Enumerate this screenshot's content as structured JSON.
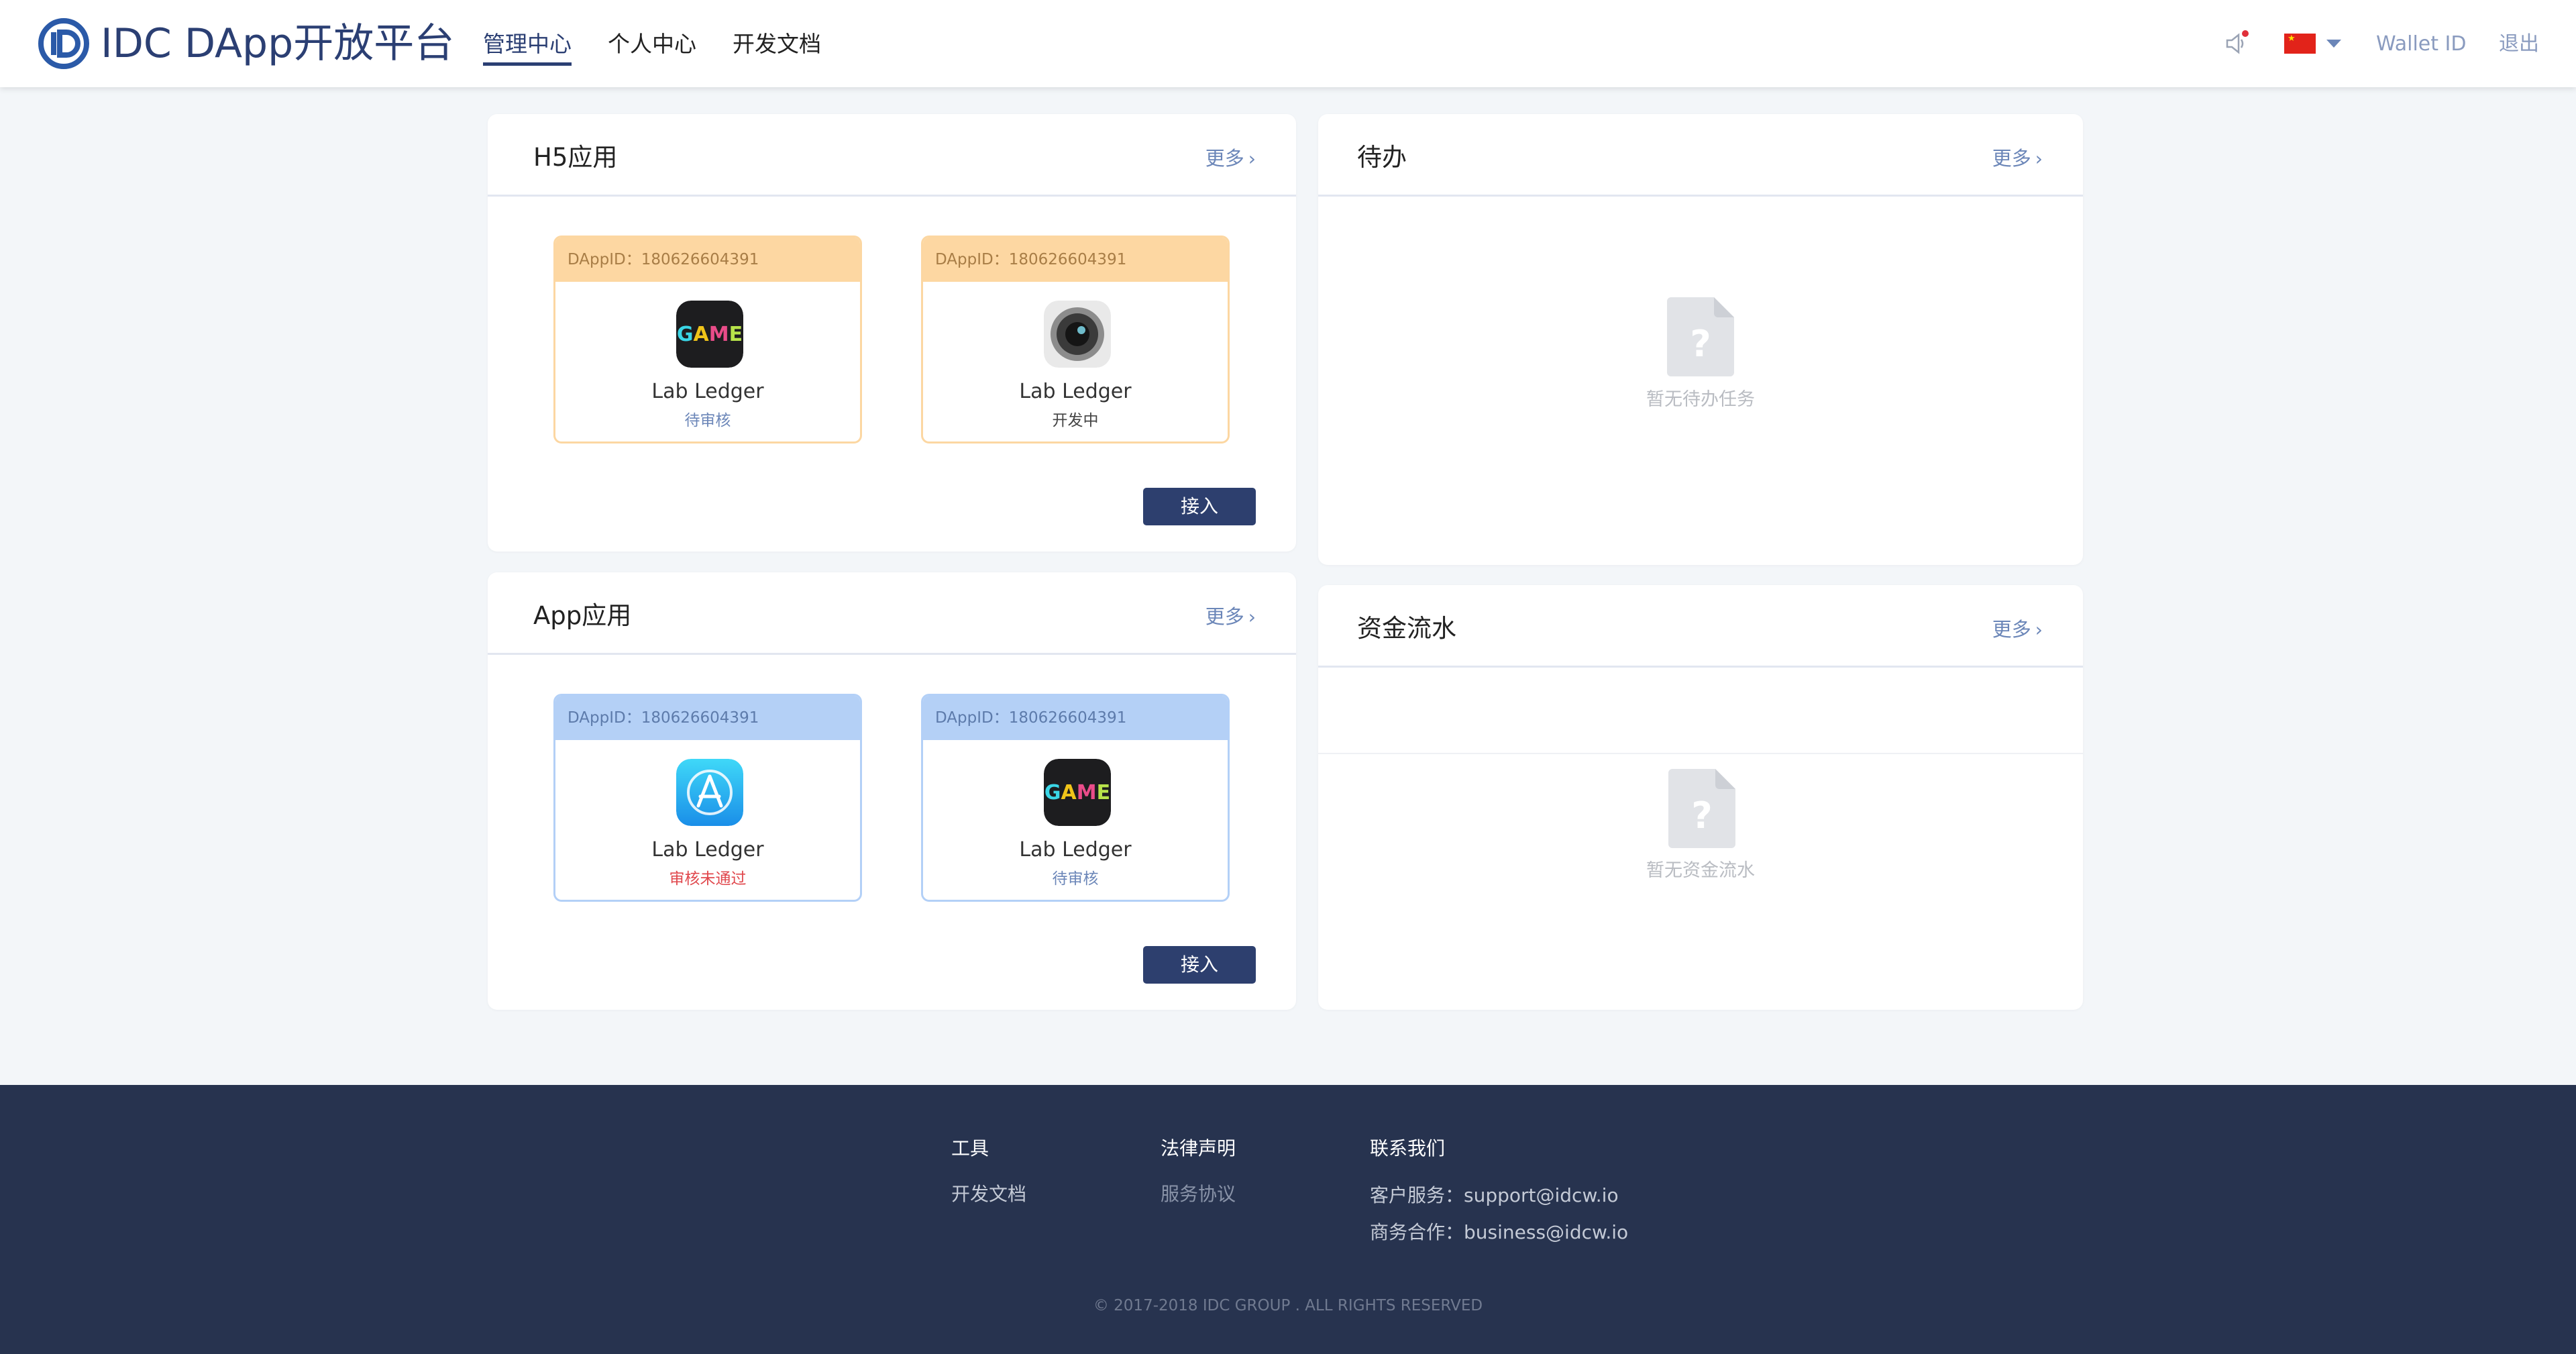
{
  "header": {
    "brand": "IDC DApp开放平台",
    "nav": [
      "管理中心",
      "个人中心",
      "开发文档"
    ],
    "wallet_label": "Wallet ID",
    "logout_label": "退出"
  },
  "h5_panel": {
    "title": "H5应用",
    "more": "更多",
    "cards": [
      {
        "id": "DAppID：180626604391",
        "name": "Lab Ledger",
        "status": "待审核",
        "icon": "game-icon"
      },
      {
        "id": "DAppID：180626604391",
        "name": "Lab Ledger",
        "status": "开发中",
        "icon": "camera-lens-icon"
      }
    ],
    "join": "接入"
  },
  "app_panel": {
    "title": "App应用",
    "more": "更多",
    "cards": [
      {
        "id": "DAppID：180626604391",
        "name": "Lab Ledger",
        "status": "审核未通过",
        "icon": "app-store-icon"
      },
      {
        "id": "DAppID：180626604391",
        "name": "Lab Ledger",
        "status": "待审核",
        "icon": "game-icon"
      }
    ],
    "join": "接入"
  },
  "todo_panel": {
    "title": "待办",
    "more": "更多",
    "empty": "暂无待办任务"
  },
  "funds_panel": {
    "title": "资金流水",
    "more": "更多",
    "empty": "暂无资金流水"
  },
  "footer": {
    "tools_head": "工具",
    "tools_link": "开发文档",
    "legal_head": "法律声明",
    "legal_link": "服务协议",
    "contact_head": "联系我们",
    "support": "客户服务：support@idcw.io",
    "business": "商务合作：business@idcw.io",
    "copyright": "© 2017-2018 IDC GROUP . ALL RIGHTS RESERVED"
  },
  "colors": {
    "brand": "#2b3f73",
    "button": "#2d3f6e",
    "h5_card_header": "#fdd7a2",
    "app_card_header": "#b4d0f6",
    "status_rejected": "#e0474c",
    "footer_bg": "#27334f"
  }
}
